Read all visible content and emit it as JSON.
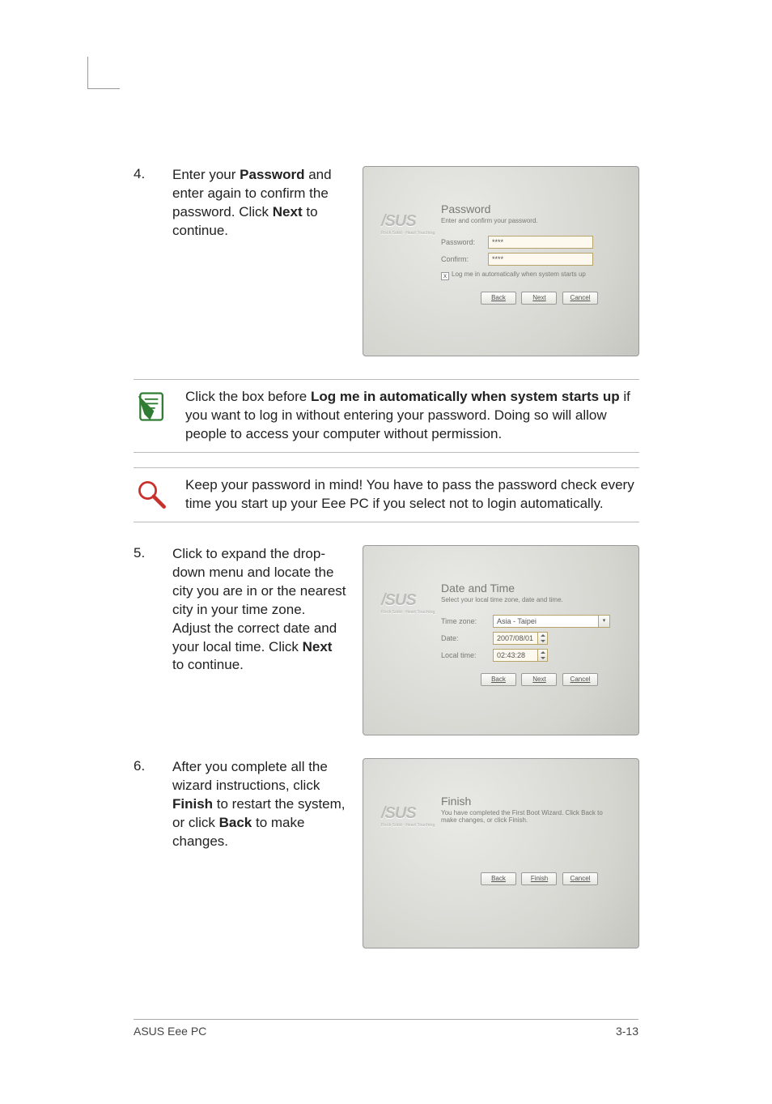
{
  "steps": {
    "s4": {
      "num": "4.",
      "text_before_bold1": "Enter your ",
      "bold1": "Password",
      "text_mid": " and enter again to confirm the password. Click ",
      "bold2": "Next",
      "text_after": " to continue."
    },
    "s5": {
      "num": "5.",
      "text_before": "Click to expand the drop-down menu and locate the city you are in or the nearest city in your time zone. Adjust the correct date and your local time. Click ",
      "bold": "Next",
      "text_after": " to continue."
    },
    "s6": {
      "num": "6.",
      "text_before": "After you complete all the wizard instructions, click ",
      "bold1": "Finish",
      "text_mid": " to restart the system, or click ",
      "bold2": "Back",
      "text_after": " to make changes."
    }
  },
  "shot1": {
    "title": "Password",
    "sub": "Enter and confirm your password.",
    "lbl_password": "Password:",
    "lbl_confirm": "Confirm:",
    "val_password": "****",
    "val_confirm": "****",
    "checkbox_checked": "x",
    "checkbox_label": "Log me in automatically when system starts up",
    "back": "Back",
    "next": "Next",
    "cancel": "Cancel"
  },
  "shot2": {
    "title": "Date and Time",
    "sub": "Select your local time zone, date and time.",
    "lbl_tz": "Time zone:",
    "lbl_date": "Date:",
    "lbl_time": "Local time:",
    "val_tz": "Asia - Taipei",
    "val_date": "2007/08/01",
    "val_time": "02:43:28",
    "back": "Back",
    "next": "Next",
    "cancel": "Cancel"
  },
  "shot3": {
    "title": "Finish",
    "sub": "You have completed the First Boot Wizard. Click Back to make changes, or click Finish.",
    "back": "Back",
    "finish": "Finish",
    "cancel": "Cancel"
  },
  "note1": {
    "pre": "Click the box before ",
    "bold": "Log me in automatically when system starts up",
    "post": " if you want to log in without entering your password. Doing so will allow people to access your computer without permission."
  },
  "note2": {
    "text": "Keep your password in mind! You have to pass the password check every time you start up your Eee PC if you select not to login automatically."
  },
  "logo": {
    "brand": "/SUS",
    "tag": "Rock Solid · Heart Touching"
  },
  "footer": {
    "left": "ASUS Eee PC",
    "right": "3-13"
  }
}
